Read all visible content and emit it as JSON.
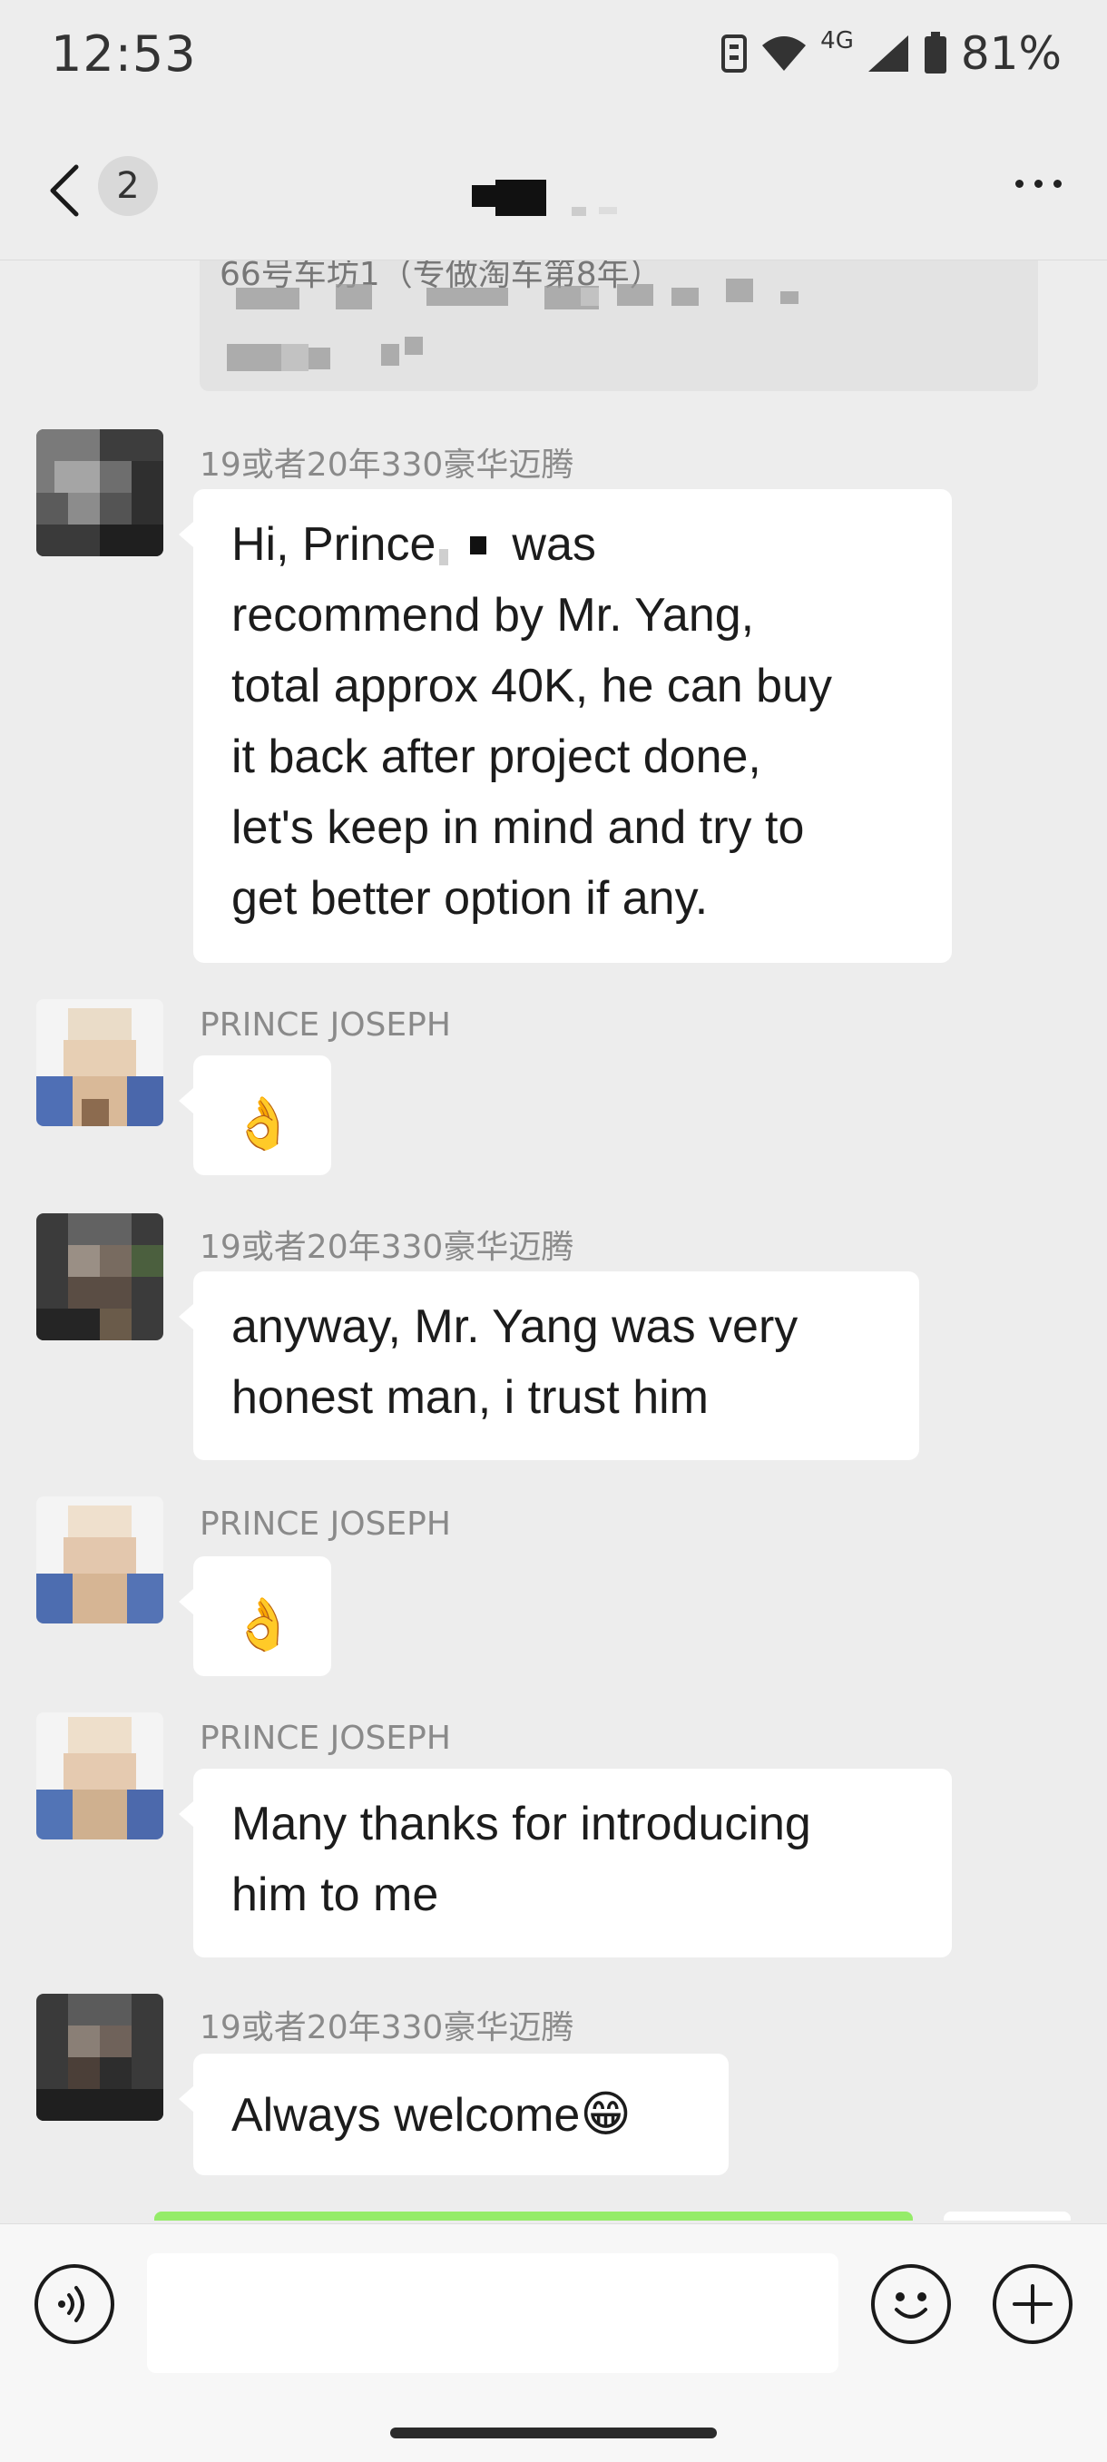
{
  "status_bar": {
    "time": "12:53",
    "network": "4G",
    "battery": "81%"
  },
  "nav": {
    "unread_count": "2"
  },
  "quoted": {
    "text": "66号车坊1（专做淘车第8年）"
  },
  "messages": [
    {
      "sender": "19或者20年330豪华迈腾",
      "lines": [
        "Hi, Prince",
        "was",
        "recommend by Mr. Yang,",
        "total approx 40K, he can buy",
        "it back after project done,",
        "let's keep in mind and try to",
        "get better option if any."
      ]
    },
    {
      "sender": "PRINCE JOSEPH",
      "emoji": "👌"
    },
    {
      "sender": "19或者20年330豪华迈腾",
      "lines": [
        "anyway, Mr. Yang was very",
        "honest man, i trust him"
      ]
    },
    {
      "sender": "PRINCE JOSEPH",
      "emoji": "👌"
    },
    {
      "sender": "PRINCE JOSEPH",
      "lines": [
        "Many thanks for introducing",
        "him to me"
      ]
    },
    {
      "sender": "19或者20年330豪华迈腾",
      "lines": [
        "Always welcome"
      ],
      "emoji": "😁"
    }
  ],
  "input": {
    "placeholder": ""
  },
  "colors": {
    "background": "#ededed",
    "bubble": "#ffffff",
    "sent_bubble": "#95ec69"
  }
}
